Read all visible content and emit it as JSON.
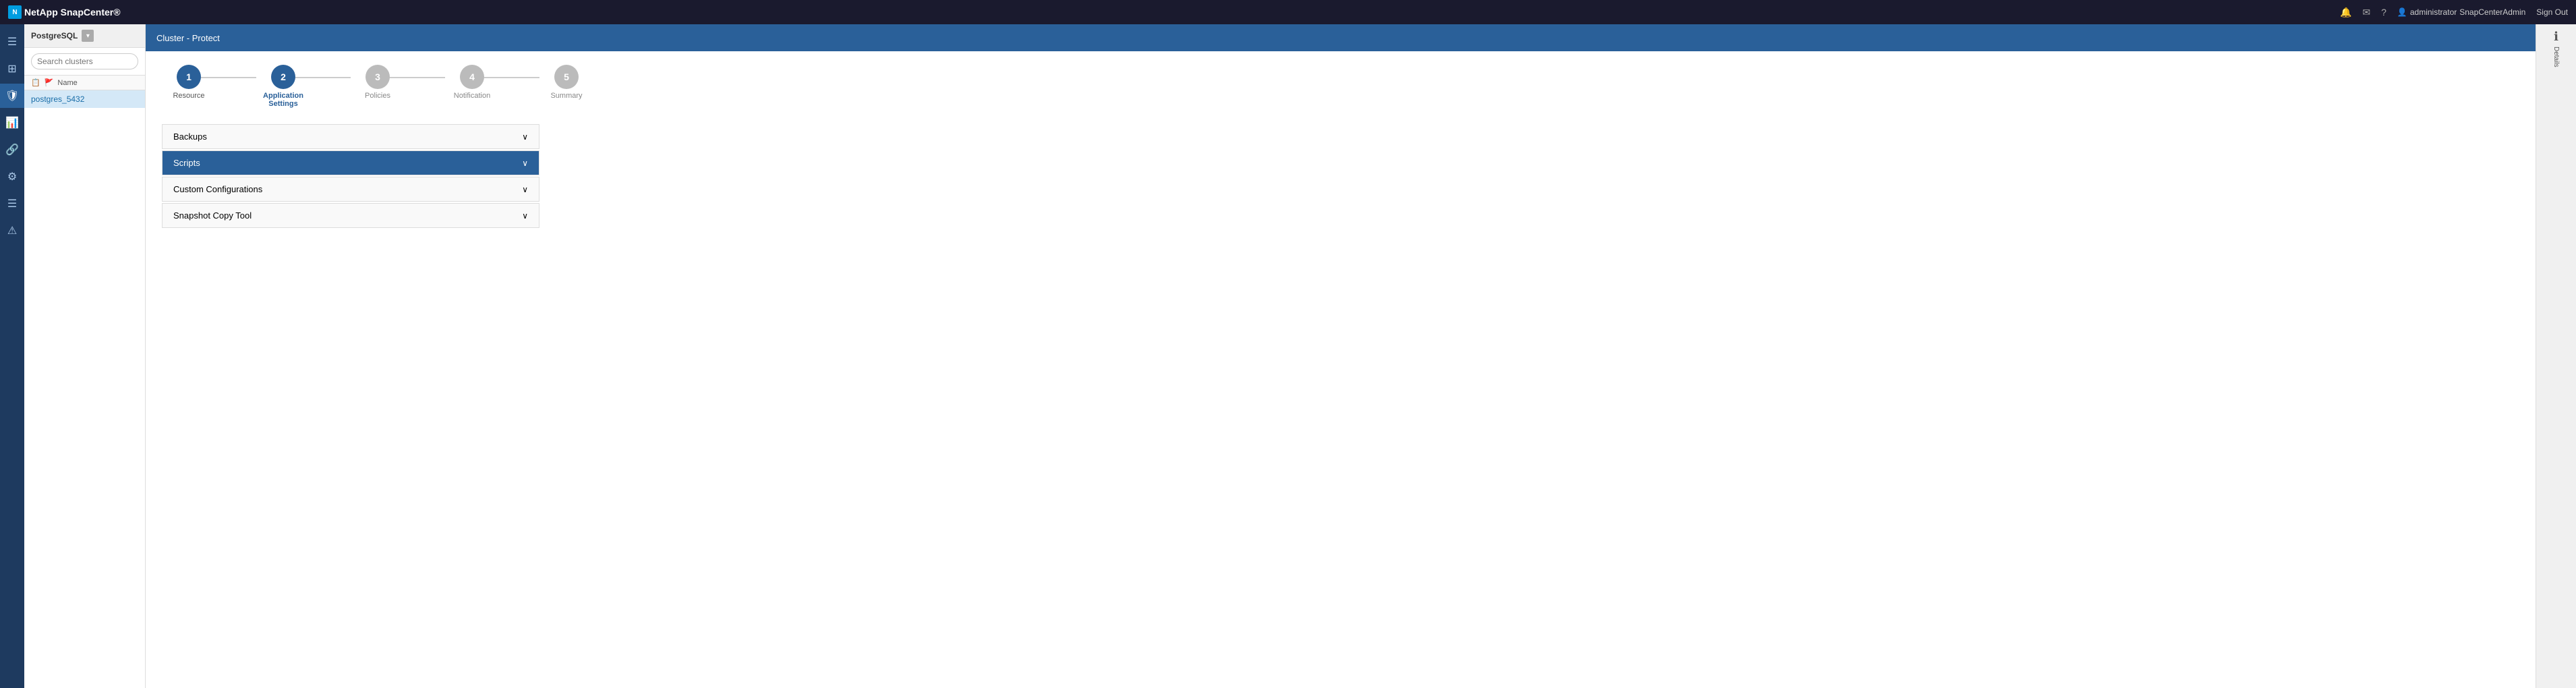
{
  "app": {
    "name": "NetApp",
    "product": "SnapCenter®"
  },
  "header": {
    "breadcrumb": "Cluster - Protect",
    "close_label": "×",
    "icons": [
      "bell",
      "mail",
      "help",
      "user"
    ],
    "user": "administrator",
    "instance": "SnapCenterAdmin",
    "signout": "Sign Out"
  },
  "sidebar": {
    "plugin_label": "PostgreSQL",
    "search_placeholder": "Search clusters",
    "table_header": "Name",
    "items": [
      {
        "label": "postgres_5432",
        "selected": true
      }
    ]
  },
  "wizard": {
    "steps": [
      {
        "number": "1",
        "label": "Resource",
        "state": "done"
      },
      {
        "number": "2",
        "label": "Application Settings",
        "state": "active"
      },
      {
        "number": "3",
        "label": "Policies",
        "state": "pending"
      },
      {
        "number": "4",
        "label": "Notification",
        "state": "pending"
      },
      {
        "number": "5",
        "label": "Summary",
        "state": "pending"
      }
    ]
  },
  "accordion": {
    "sections": [
      {
        "label": "Backups",
        "active": false
      },
      {
        "label": "Scripts",
        "active": true
      },
      {
        "label": "Custom Configurations",
        "active": false
      },
      {
        "label": "Snapshot Copy Tool",
        "active": false
      }
    ]
  },
  "details_panel": {
    "label": "Details"
  },
  "icons": {
    "bell": "🔔",
    "mail": "✉",
    "help": "?",
    "user": "👤",
    "chevron_down": "∨",
    "chevron_right": ">",
    "menu": "≡",
    "home": "⌂",
    "grid": "⊞",
    "shield": "🛡",
    "chart": "📊",
    "settings": "⚙",
    "nodes": "⋮",
    "list": "☰",
    "warning": "⚠",
    "info": "ℹ"
  }
}
